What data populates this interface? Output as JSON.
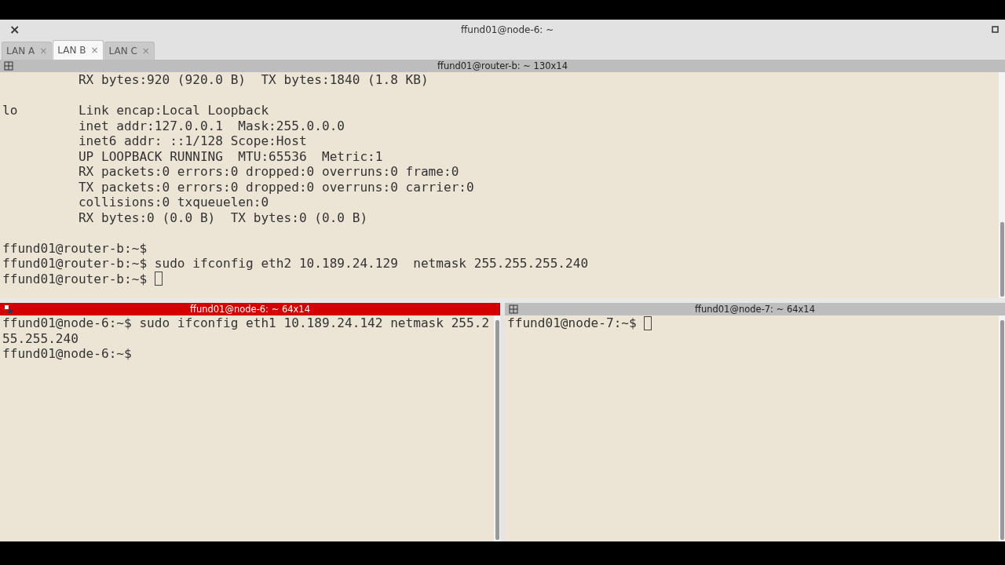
{
  "window": {
    "title": "ffund01@node-6: ~",
    "close": "×"
  },
  "tabs": [
    {
      "label": "LAN A",
      "selected": false
    },
    {
      "label": "LAN B",
      "selected": true
    },
    {
      "label": "LAN C",
      "selected": false
    }
  ],
  "panes": [
    {
      "title": "ffund01@router-b: ~ 130x14",
      "focused": false,
      "cursor": true,
      "blocks": [
        [
          "          RX bytes:920 (920.0 B)  TX bytes:1840 (1.8 KB)"
        ],
        [
          "lo        Link encap:Local Loopback",
          "          inet addr:127.0.0.1  Mask:255.0.0.0",
          "          inet6 addr: ::1/128 Scope:Host",
          "          UP LOOPBACK RUNNING  MTU:65536  Metric:1",
          "          RX packets:0 errors:0 dropped:0 overruns:0 frame:0",
          "          TX packets:0 errors:0 dropped:0 overruns:0 carrier:0",
          "          collisions:0 txqueuelen:0",
          "          RX bytes:0 (0.0 B)  TX bytes:0 (0.0 B)"
        ],
        [
          "ffund01@router-b:~$",
          "ffund01@router-b:~$ sudo ifconfig eth2 10.189.24.129  netmask 255.255.255.240",
          "ffund01@router-b:~$ "
        ]
      ]
    },
    {
      "title": "ffund01@node-6: ~ 64x14",
      "focused": true,
      "cursor": false,
      "blocks": [
        [
          "ffund01@node-6:~$ sudo ifconfig eth1 10.189.24.142 netmask 255.2",
          "55.255.240",
          "ffund01@node-6:~$"
        ]
      ]
    },
    {
      "title": "ffund01@node-7: ~ 64x14",
      "focused": false,
      "cursor": true,
      "blocks": [
        [
          "ffund01@node-7:~$ "
        ]
      ]
    }
  ]
}
